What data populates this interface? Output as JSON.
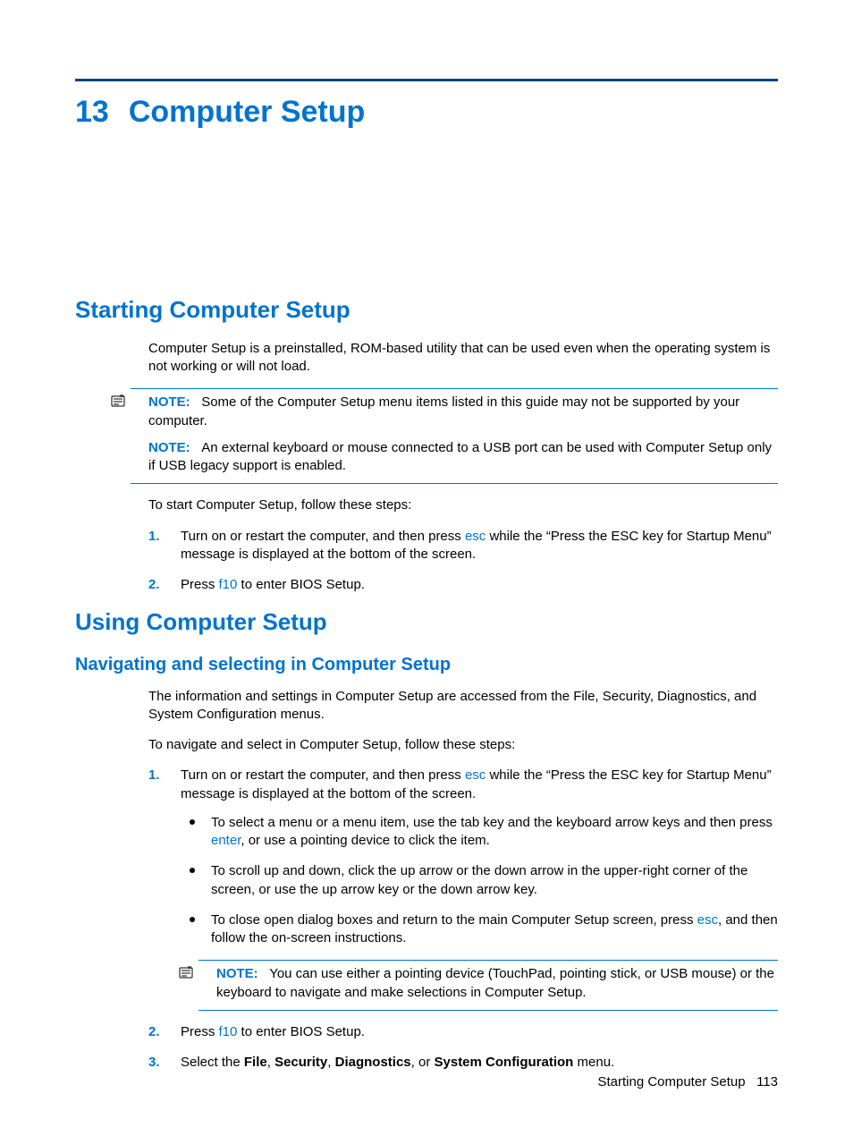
{
  "chapter": {
    "number": "13",
    "title": "Computer Setup"
  },
  "section1": {
    "heading": "Starting Computer Setup",
    "intro": "Computer Setup is a preinstalled, ROM-based utility that can be used even when the operating system is not working or will not load.",
    "note_label": "NOTE:",
    "note1": "Some of the Computer Setup menu items listed in this guide may not be supported by your computer.",
    "note2": "An external keyboard or mouse connected to a USB port can be used with Computer Setup only if USB legacy support is enabled.",
    "lead": "To start Computer Setup, follow these steps:",
    "step1_num": "1.",
    "step1_a": "Turn on or restart the computer, and then press ",
    "step1_key": "esc",
    "step1_b": " while the “Press the ESC key for Startup Menu” message is displayed at the bottom of the screen.",
    "step2_num": "2.",
    "step2_a": "Press ",
    "step2_key": "f10",
    "step2_b": " to enter BIOS Setup."
  },
  "section2": {
    "heading": "Using Computer Setup",
    "sub_heading": "Navigating and selecting in Computer Setup",
    "p1": "The information and settings in Computer Setup are accessed from the File, Security, Diagnostics, and System Configuration menus.",
    "p2": "To navigate and select in Computer Setup, follow these steps:",
    "step1_num": "1.",
    "step1_a": "Turn on or restart the computer, and then press ",
    "step1_key": "esc",
    "step1_b": " while the “Press the ESC key for Startup Menu” message is displayed at the bottom of the screen.",
    "bullet1_a": "To select a menu or a menu item, use the tab key and the keyboard arrow keys and then press ",
    "bullet1_key": "enter",
    "bullet1_b": ", or use a pointing device to click the item.",
    "bullet2": "To scroll up and down, click the up arrow or the down arrow in the upper-right corner of the screen, or use the up arrow key or the down arrow key.",
    "bullet3_a": "To close open dialog boxes and return to the main Computer Setup screen, press ",
    "bullet3_key": "esc",
    "bullet3_b": ", and then follow the on-screen instructions.",
    "note_label": "NOTE:",
    "note": "You can use either a pointing device (TouchPad, pointing stick, or USB mouse) or the keyboard to navigate and make selections in Computer Setup.",
    "step2_num": "2.",
    "step2_a": "Press ",
    "step2_key": "f10",
    "step2_b": " to enter BIOS Setup.",
    "step3_num": "3.",
    "step3_a": "Select the ",
    "step3_m1": "File",
    "step3_s1": ", ",
    "step3_m2": "Security",
    "step3_s2": ", ",
    "step3_m3": "Diagnostics",
    "step3_s3": ", or ",
    "step3_m4": "System Configuration",
    "step3_b": " menu."
  },
  "footer": {
    "text": "Starting Computer Setup",
    "page": "113"
  }
}
